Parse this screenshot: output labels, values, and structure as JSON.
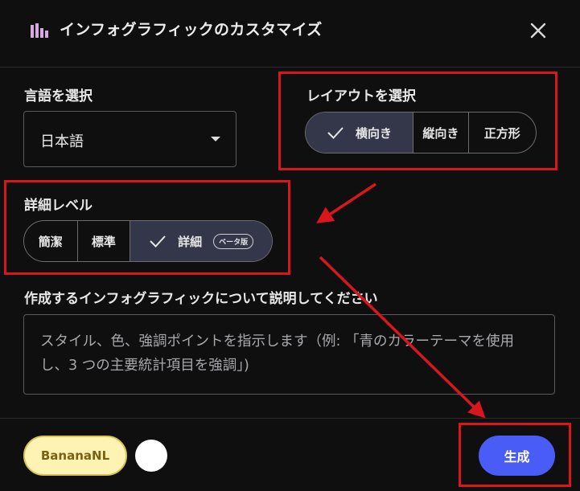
{
  "header": {
    "title": "インフォグラフィックのカスタマイズ",
    "icon": "bar-chart-icon",
    "close_icon": "close-icon"
  },
  "language": {
    "label": "言語を選択",
    "selected": "日本語"
  },
  "layout": {
    "label": "レイアウトを選択",
    "options": [
      "横向き",
      "縦向き",
      "正方形"
    ],
    "selected": "横向き"
  },
  "detail": {
    "label": "詳細レベル",
    "options": [
      "簡潔",
      "標準",
      "詳細"
    ],
    "selected": "詳細",
    "beta_badge": "ベータ版"
  },
  "description": {
    "label": "作成するインフォグラフィックについて説明してください",
    "placeholder": "スタイル、色、強調ポイントを指示します（例: 「青のカラーテーマを使用し、3 つの主要統計項目を強調」)"
  },
  "footer": {
    "style_chip": "BananaNL",
    "generate_label": "生成"
  },
  "colors": {
    "background": "#0f0f10",
    "accent": "#4a5cf6",
    "selected_segment": "#34374a",
    "annotation": "#d8161d",
    "chip_bg": "#fff3b3"
  }
}
